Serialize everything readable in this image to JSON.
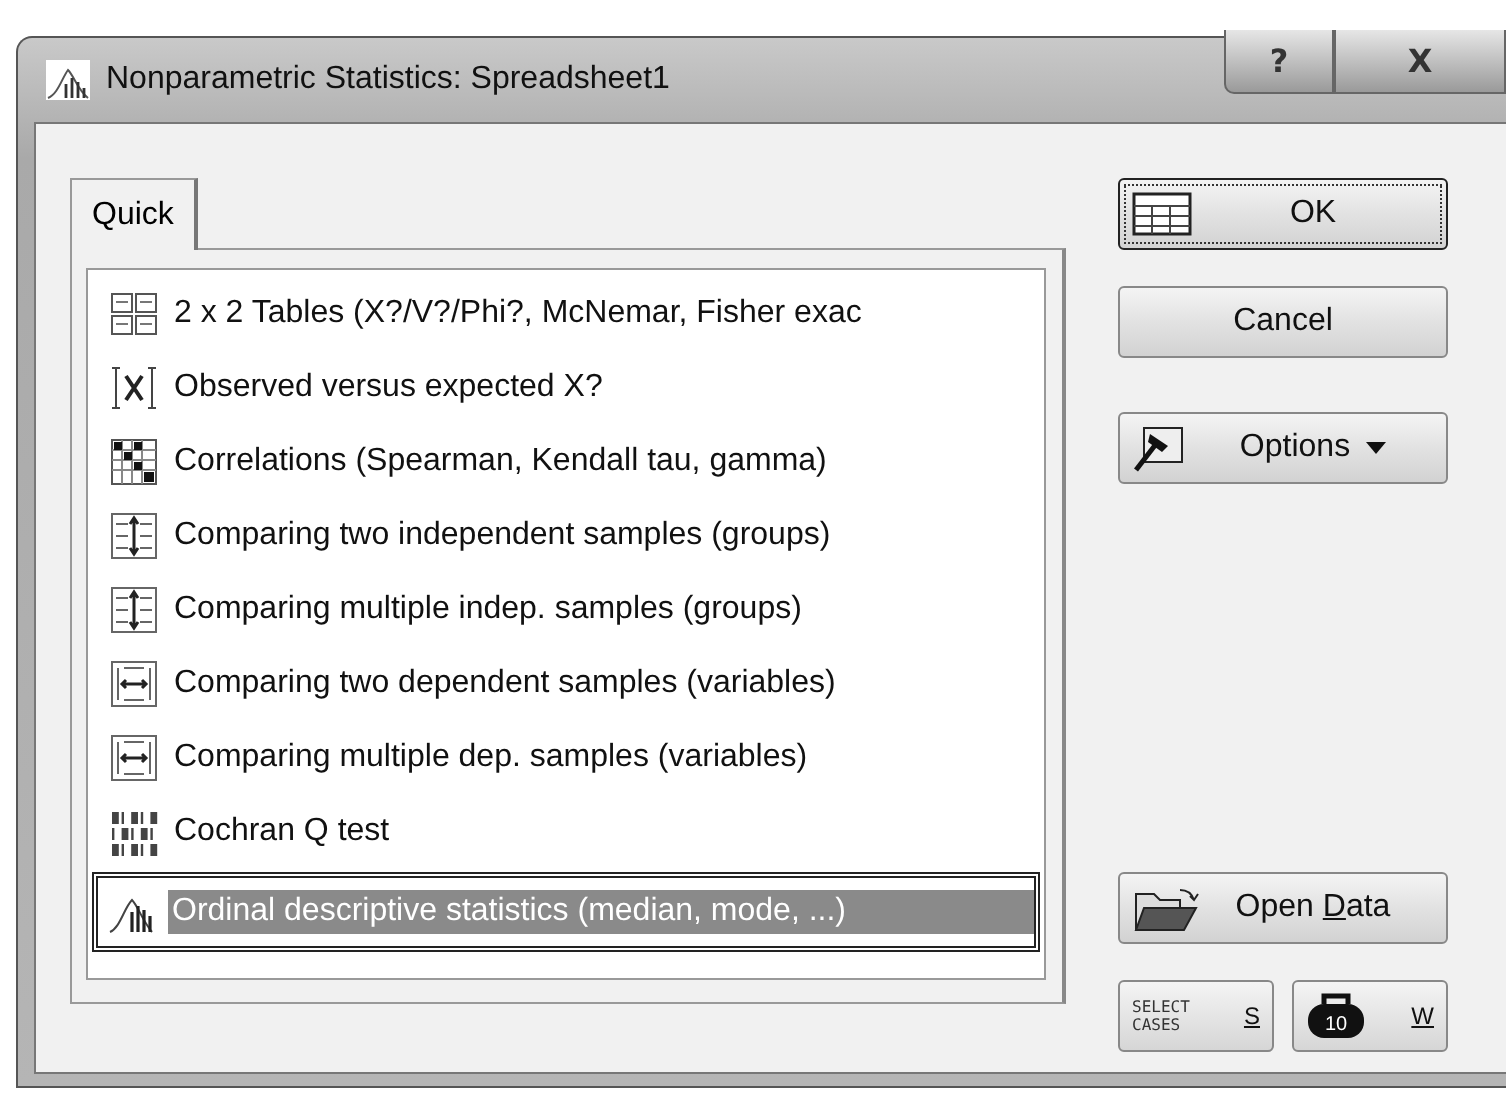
{
  "window": {
    "title": "Nonparametric Statistics: Spreadsheet1",
    "help": "?",
    "close": "X"
  },
  "tabs": [
    {
      "label": "Quick",
      "selected": true
    }
  ],
  "analyses": [
    {
      "label": "2 x 2 Tables (X?/V?/Phi?, McNemar, Fisher exac",
      "kind": "table2x2",
      "selected": false
    },
    {
      "label": "Observed versus expected X?",
      "kind": "observed",
      "selected": false
    },
    {
      "label": "Correlations (Spearman, Kendall tau, gamma)",
      "kind": "matrix",
      "selected": false
    },
    {
      "label": "Comparing two independent samples (groups)",
      "kind": "indep",
      "selected": false
    },
    {
      "label": "Comparing multiple indep. samples (groups)",
      "kind": "indep",
      "selected": false
    },
    {
      "label": "Comparing two dependent samples (variables)",
      "kind": "dep",
      "selected": false
    },
    {
      "label": "Comparing multiple dep. samples (variables)",
      "kind": "dep",
      "selected": false
    },
    {
      "label": "Cochran Q test",
      "kind": "binary",
      "selected": false
    },
    {
      "label": "Ordinal descriptive statistics (median, mode, ...)",
      "kind": "histogram",
      "selected": true
    }
  ],
  "buttons": [
    {
      "kind": "ok",
      "label": "OK"
    },
    {
      "kind": "plain",
      "label": "Cancel"
    },
    {
      "kind": "options",
      "label": "Options"
    },
    {
      "kind": "open",
      "label_parts": [
        "Open ",
        "D",
        "ata"
      ]
    }
  ],
  "small_buttons": [
    {
      "kind": "select",
      "caption": "SELECT CASES",
      "key": "S"
    },
    {
      "kind": "weight",
      "caption": "10",
      "key": "W"
    }
  ]
}
